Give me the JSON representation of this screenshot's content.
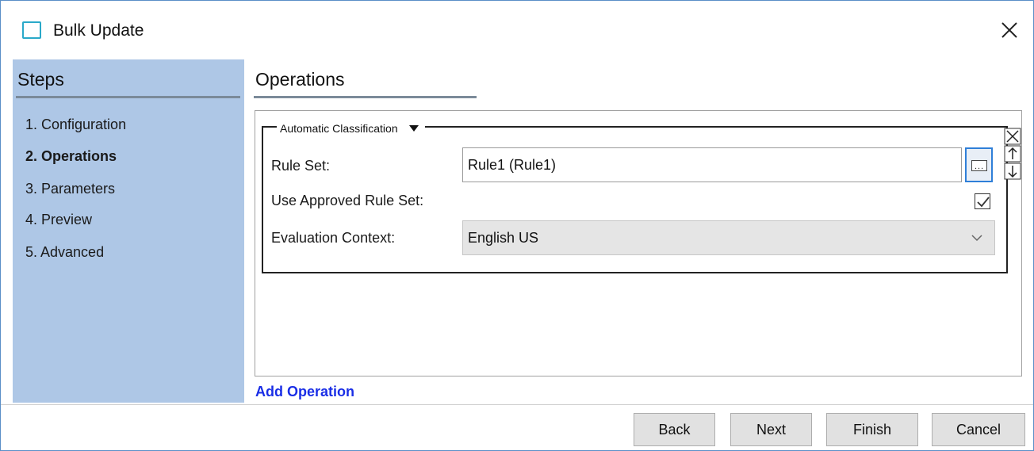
{
  "window": {
    "title": "Bulk Update",
    "icon": "window-icon",
    "close_icon": "close-icon"
  },
  "sidebar": {
    "title": "Steps",
    "items": [
      {
        "label": "1. Configuration",
        "active": false
      },
      {
        "label": "2. Operations",
        "active": true
      },
      {
        "label": "3. Parameters",
        "active": false
      },
      {
        "label": "4. Preview",
        "active": false
      },
      {
        "label": "5. Advanced",
        "active": false
      }
    ]
  },
  "main": {
    "title": "Operations",
    "operation": {
      "type_label": "Automatic Classification",
      "rule_set": {
        "label": "Rule Set:",
        "value": "Rule1 (Rule1)",
        "browse_icon": "ellipsis-icon"
      },
      "use_approved": {
        "label": "Use Approved Rule Set:",
        "checked": true
      },
      "evaluation_context": {
        "label": "Evaluation Context:",
        "value": "English US"
      },
      "side_icons": [
        "remove-icon",
        "move-up-icon",
        "move-down-icon"
      ]
    },
    "add_operation_label": "Add Operation"
  },
  "footer": {
    "back": "Back",
    "next": "Next",
    "finish": "Finish",
    "cancel": "Cancel"
  },
  "colors": {
    "sidebar_bg": "#aec7e6",
    "link": "#1a2ee6",
    "focus": "#2f7fd8"
  }
}
